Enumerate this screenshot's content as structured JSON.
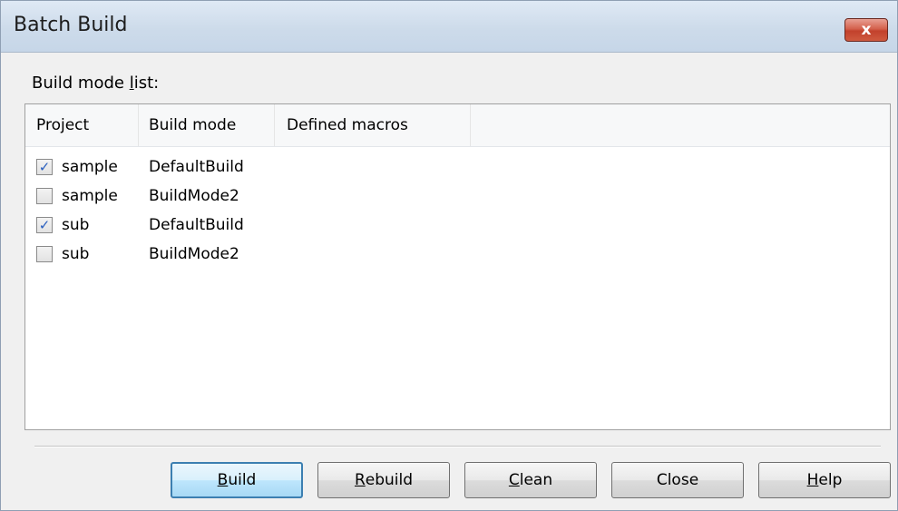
{
  "window": {
    "title": "Batch Build",
    "close_label": "x"
  },
  "list_label": {
    "prefix": "Build mode ",
    "mnemonic": "l",
    "suffix": "ist:"
  },
  "columns": [
    "Project",
    "Build mode",
    "Defined macros"
  ],
  "rows": [
    {
      "checked": true,
      "check": "✓",
      "project": "sample",
      "build_mode": "DefaultBuild",
      "macros": ""
    },
    {
      "checked": false,
      "check": "",
      "project": "sample",
      "build_mode": "BuildMode2",
      "macros": ""
    },
    {
      "checked": true,
      "check": "✓",
      "project": "sub",
      "build_mode": "DefaultBuild",
      "macros": ""
    },
    {
      "checked": false,
      "check": "",
      "project": "sub",
      "build_mode": "BuildMode2",
      "macros": ""
    }
  ],
  "buttons": {
    "build": {
      "mnemonic": "B",
      "rest": "uild"
    },
    "rebuild": {
      "mnemonic": "R",
      "rest": "ebuild"
    },
    "clean": {
      "mnemonic": "C",
      "rest": "lean"
    },
    "close": {
      "label": "Close"
    },
    "help": {
      "mnemonic": "H",
      "rest": "elp"
    }
  },
  "colors": {
    "title_bar": "#cddbea",
    "default_button_border": "#3c7fb1",
    "close_button": "#c2412c",
    "checkmark": "#2a5fbf"
  }
}
